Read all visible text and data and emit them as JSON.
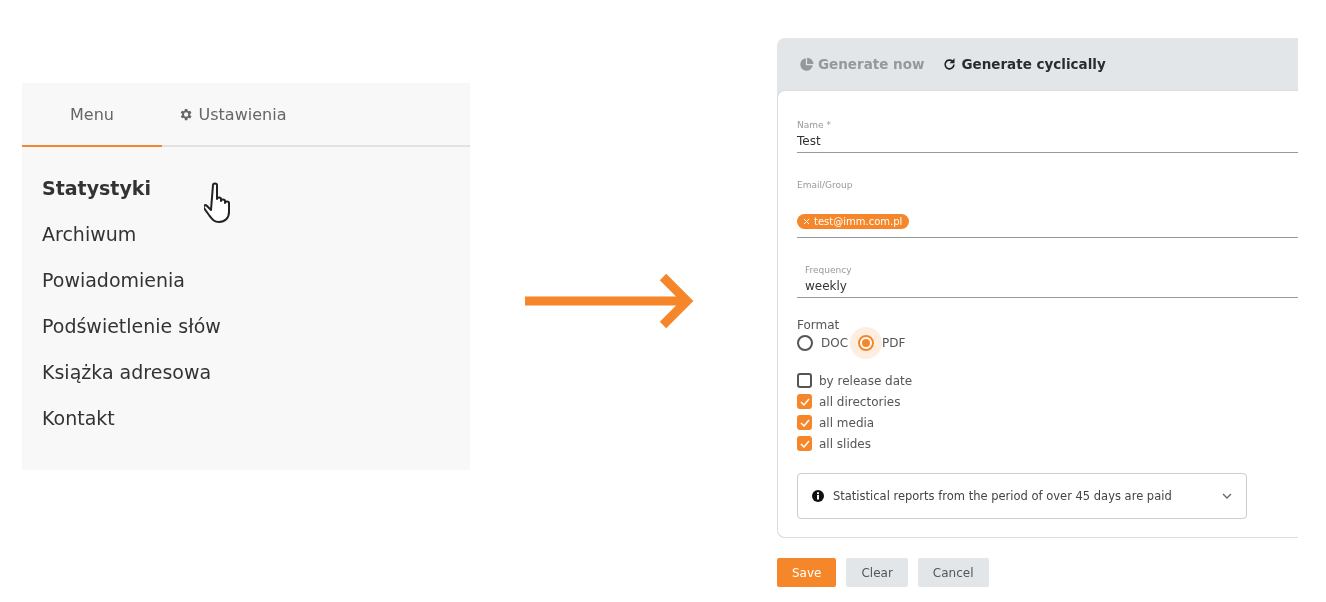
{
  "menu_panel": {
    "tabs": [
      {
        "label": "Menu",
        "kind": "plain",
        "selected": true
      },
      {
        "label": "Ustawienia",
        "kind": "settings",
        "selected": false
      }
    ],
    "items": [
      {
        "label": "Statystyki",
        "selected": true
      },
      {
        "label": "Archiwum",
        "selected": false
      },
      {
        "label": "Powiadomienia",
        "selected": false
      },
      {
        "label": "Podświetlenie słów",
        "selected": false
      },
      {
        "label": "Książka adresowa",
        "selected": false
      },
      {
        "label": "Kontakt",
        "selected": false
      }
    ]
  },
  "report_form": {
    "tabs": [
      {
        "label": "Generate now",
        "kind": "instant",
        "selected": false,
        "disabled": true
      },
      {
        "label": "Generate cyclically",
        "kind": "cyclic",
        "selected": true,
        "disabled": false
      }
    ],
    "name": {
      "label": "Name *",
      "value": "Test"
    },
    "email": {
      "label": "Email/Group",
      "chips": [
        "test@imm.com.pl"
      ]
    },
    "frequency": {
      "label": "Frequency",
      "value": "weekly"
    },
    "format": {
      "label": "Format",
      "options": [
        {
          "label": "DOC",
          "selected": false
        },
        {
          "label": "PDF",
          "selected": true
        }
      ]
    },
    "checkboxes": [
      {
        "label": "by release date",
        "checked": false
      },
      {
        "label": "all directories",
        "checked": true
      },
      {
        "label": "all media",
        "checked": true
      },
      {
        "label": "all slides",
        "checked": true
      }
    ],
    "info": {
      "text": "Statistical reports from the period of over 45 days are paid",
      "expanded": false
    },
    "buttons": [
      {
        "label": "Save",
        "kind": "primary"
      },
      {
        "label": "Clear",
        "kind": "secondary"
      },
      {
        "label": "Cancel",
        "kind": "secondary"
      }
    ]
  }
}
